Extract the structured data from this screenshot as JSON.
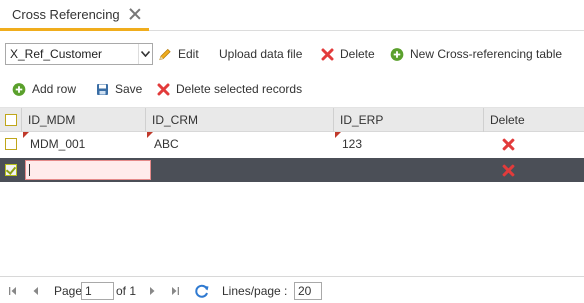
{
  "tab": {
    "title": "Cross Referencing"
  },
  "toolbar": {
    "table_select_value": "X_Ref_Customer",
    "edit_label": "Edit",
    "upload_label": "Upload data file",
    "delete_label": "Delete",
    "new_table_label": "New Cross-referencing table"
  },
  "actions": {
    "add_row_label": "Add row",
    "save_label": "Save",
    "delete_selected_label": "Delete selected records"
  },
  "grid": {
    "columns": [
      "ID_MDM",
      "ID_CRM",
      "ID_ERP",
      "Delete"
    ],
    "rows": [
      {
        "id_mdm": "MDM_001",
        "id_crm": "ABC",
        "id_erp": "123",
        "checked": false
      },
      {
        "id_mdm": "",
        "id_crm": "",
        "id_erp": "",
        "checked": true
      }
    ]
  },
  "pager": {
    "page_label": "Page",
    "page_value": "1",
    "of_label": "of 1",
    "lines_label": "Lines/page :",
    "lines_value": "20"
  },
  "colors": {
    "accent": "#f0ad1d",
    "selected_row": "#4b4f57",
    "delete_red": "#e23b3b",
    "add_green": "#5aa02c",
    "save_blue": "#3a6ea5"
  }
}
